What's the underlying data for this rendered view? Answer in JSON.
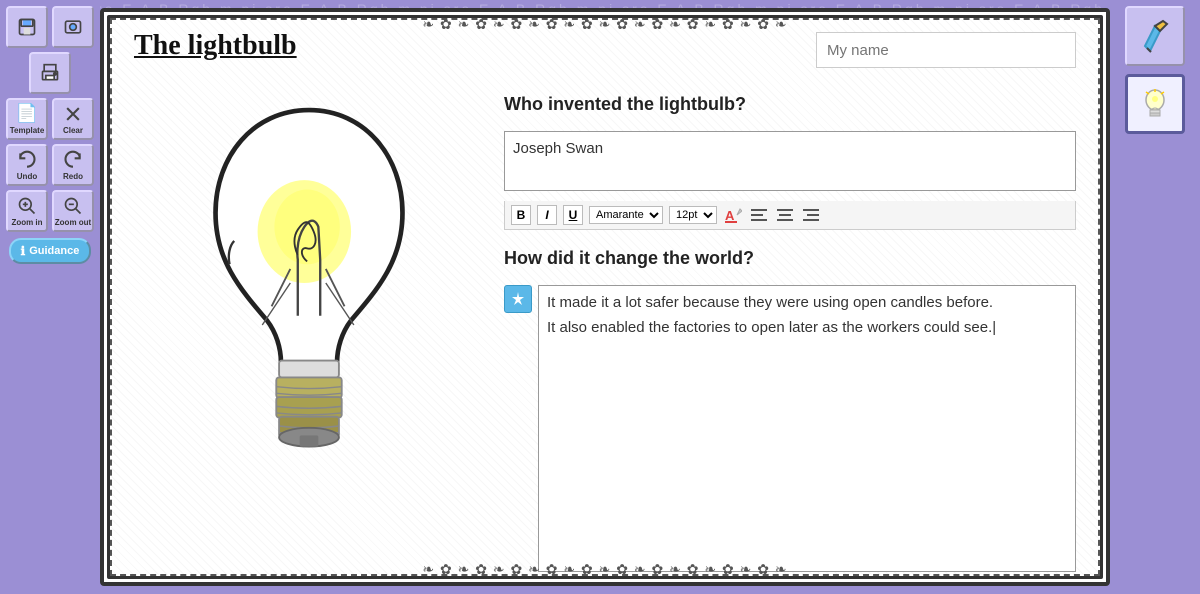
{
  "app": {
    "title": "The lightbulb"
  },
  "toolbar": {
    "buttons": [
      {
        "id": "save",
        "label": "Save",
        "icon": "💾"
      },
      {
        "id": "print",
        "label": "Print",
        "icon": "🖨️"
      },
      {
        "id": "template",
        "label": "Template",
        "icon": "📄"
      },
      {
        "id": "clear",
        "label": "Clear",
        "icon": "✖"
      },
      {
        "id": "undo",
        "label": "Undo",
        "icon": "↩"
      },
      {
        "id": "redo",
        "label": "Redo",
        "icon": "↪"
      },
      {
        "id": "zoom-in",
        "label": "Zoom in",
        "icon": "🔍"
      },
      {
        "id": "zoom-out",
        "label": "Zoom out",
        "icon": "🔍"
      },
      {
        "id": "guidance",
        "label": "Guidance",
        "icon": "ℹ"
      }
    ]
  },
  "right_panel": {
    "buttons": [
      {
        "id": "pen",
        "label": "Pen tool",
        "icon": "✏️"
      },
      {
        "id": "lightbulb",
        "label": "Lightbulb",
        "icon": "💡"
      }
    ]
  },
  "page": {
    "title": "The lightbulb",
    "name_placeholder": "My name",
    "name_value": "",
    "question1": {
      "label": "Who invented the lightbulb?",
      "answer": "Joseph Swan"
    },
    "question2": {
      "label": "How did it change the world?",
      "answer_line1": "It made it a lot safer because they were using open candles before.",
      "answer_line2": "It also enabled the factories to open later as the workers could see."
    },
    "formatting": {
      "bold": "B",
      "italic": "I",
      "underline": "U",
      "font": "Amarante",
      "size": "12pt"
    }
  }
}
